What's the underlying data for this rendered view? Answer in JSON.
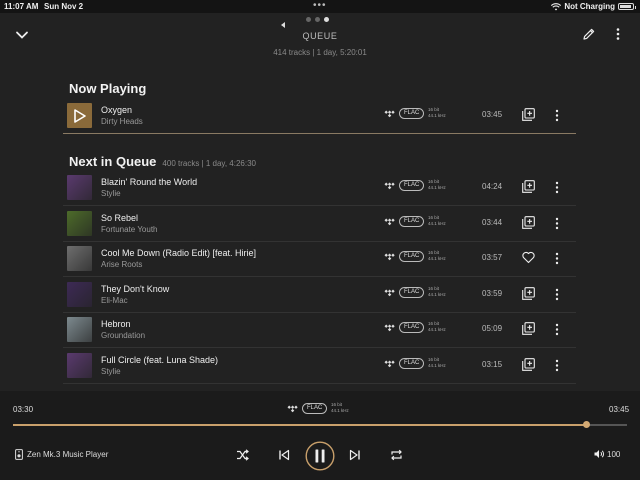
{
  "status_bar": {
    "time": "11:07 AM",
    "date": "Sun Nov 2",
    "dots": "•••",
    "charging": "Not Charging",
    "battery_level": 0.9
  },
  "header": {
    "title": "QUEUE",
    "subtitle": "414 tracks | 1 day, 5:20:01",
    "page_count": 3,
    "active_page": 2
  },
  "now_playing": {
    "heading": "Now Playing",
    "track": {
      "title": "Oxygen",
      "artist": "Dirty Heads",
      "format": "FLAC",
      "bit_depth": "16 bit",
      "sample_rate": "44.1 kHz",
      "duration": "03:45",
      "action_icon": "add-to-queue-icon"
    }
  },
  "queue": {
    "heading": "Next in Queue",
    "meta": "400 tracks | 1 day, 4:26:30",
    "tracks": [
      {
        "title": "Blazin' Round the World",
        "artist": "Stylie",
        "format": "FLAC",
        "bit_depth": "16 bit",
        "sample_rate": "44.1 kHz",
        "duration": "04:24",
        "action_icon": "add-to-queue-icon",
        "art_color": "#5a3a6e"
      },
      {
        "title": "So Rebel",
        "artist": "Fortunate Youth",
        "format": "FLAC",
        "bit_depth": "16 bit",
        "sample_rate": "44.1 kHz",
        "duration": "03:44",
        "action_icon": "add-to-queue-icon",
        "art_color": "#4d6b2a"
      },
      {
        "title": "Cool Me Down (Radio Edit) [feat. Hirie]",
        "artist": "Arise Roots",
        "format": "FLAC",
        "bit_depth": "16 bit",
        "sample_rate": "44.1 kHz",
        "duration": "03:57",
        "action_icon": "heart-icon",
        "art_color": "#6e6e6e"
      },
      {
        "title": "They Don't Know",
        "artist": "Eli-Mac",
        "format": "FLAC",
        "bit_depth": "16 bit",
        "sample_rate": "44.1 kHz",
        "duration": "03:59",
        "action_icon": "add-to-queue-icon",
        "art_color": "#3d2a55"
      },
      {
        "title": "Hebron",
        "artist": "Groundation",
        "format": "FLAC",
        "bit_depth": "16 bit",
        "sample_rate": "44.1 kHz",
        "duration": "05:09",
        "action_icon": "add-to-queue-icon",
        "art_color": "#7d8a8f"
      },
      {
        "title": "Full Circle (feat. Luna Shade)",
        "artist": "Stylie",
        "format": "FLAC",
        "bit_depth": "16 bit",
        "sample_rate": "44.1 kHz",
        "duration": "03:15",
        "action_icon": "add-to-queue-icon",
        "art_color": "#5a3a6e"
      }
    ]
  },
  "player": {
    "elapsed": "03:30",
    "total": "03:45",
    "progress": 0.933,
    "format": "FLAC",
    "bit_depth": "16 bit",
    "sample_rate": "44.1 kHz",
    "device": "Zen Mk.3 Music Player",
    "volume": "100",
    "accent_color": "#c9a06b"
  }
}
